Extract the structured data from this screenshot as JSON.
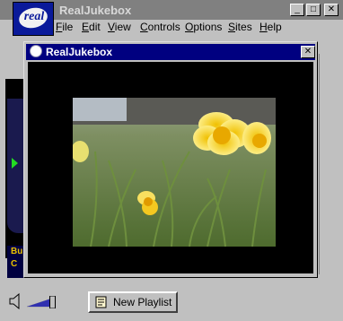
{
  "app": {
    "title": "RealJukebox",
    "logo_text": "real"
  },
  "window_buttons": {
    "minimize": "_",
    "maximize": "□",
    "close": "✕"
  },
  "menubar": [
    "File",
    "Edit",
    "View",
    "Controls",
    "Options",
    "Sites",
    "Help"
  ],
  "video_window": {
    "title": "RealJukebox",
    "close": "✕"
  },
  "promo": {
    "line1": "Bu",
    "line2": "C"
  },
  "playlist_button": {
    "label": "New Playlist"
  },
  "volume": {
    "level": 0.85
  },
  "colors": {
    "titlebar_inactive": "#808080",
    "titlebar_active": "#000080",
    "video_bg": "#000000",
    "accent_green": "#22dd22",
    "promo_text": "#e8c000"
  },
  "icons": {
    "logo": "real-logo-icon",
    "speaker": "speaker-icon",
    "playlist": "playlist-icon",
    "play": "play-arrow-icon"
  }
}
